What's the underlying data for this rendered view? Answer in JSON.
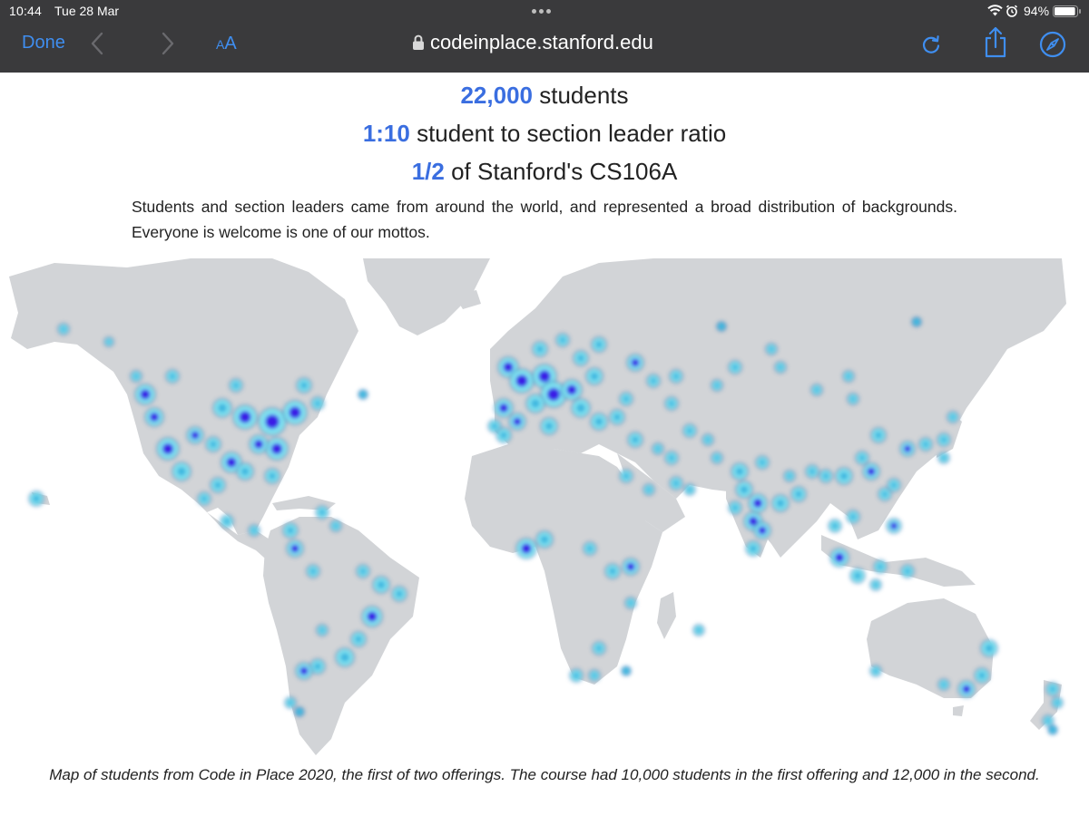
{
  "status_bar": {
    "time": "10:44",
    "date": "Tue 28 Mar",
    "battery_percent": "94%",
    "battery_level": 0.94
  },
  "toolbar": {
    "done_label": "Done",
    "text_size_small": "A",
    "text_size_large": "A",
    "url": "codeinplace.stanford.edu"
  },
  "stats": [
    {
      "value": "22,000",
      "text": " students"
    },
    {
      "value": "1:10",
      "text": " student to section leader ratio"
    },
    {
      "value": "1/2",
      "text": " of Stanford's CS106A"
    }
  ],
  "description": "Students and section leaders came from around the world, and represented a broad distribution of backgrounds. Everyone is welcome is one of our mottos.",
  "caption": "Map of students from Code in Place 2020, the first of two offerings. The course had 10,000 students in the first offering and 12,000 in the second.",
  "colors": {
    "accent": "#3f8ef0",
    "stat_highlight": "#3a6ee0",
    "chrome": "#3a3a3c",
    "land": "#d2d4d7",
    "density_low": "#7fe3f0",
    "density_mid": "#3fb8e0",
    "density_high": "#3a1fe6"
  }
}
